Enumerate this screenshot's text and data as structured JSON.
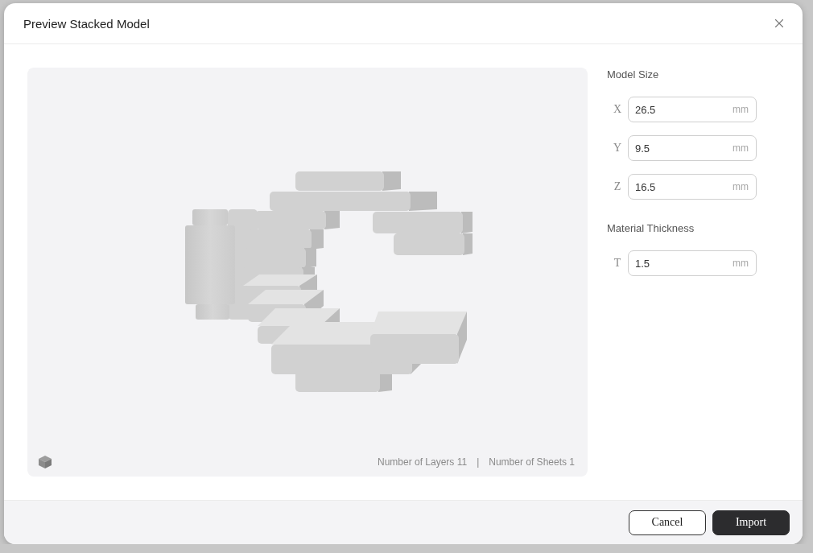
{
  "dialog": {
    "title": "Preview Stacked Model"
  },
  "viewport": {
    "stats": [
      "Number of Layers 11",
      "Number of Sheets 1"
    ],
    "separator": "|"
  },
  "panel": {
    "sections": [
      {
        "heading": "Model Size",
        "fields": [
          {
            "axis": "X",
            "value": "26.5",
            "unit": "mm"
          },
          {
            "axis": "Y",
            "value": "9.5",
            "unit": "mm"
          },
          {
            "axis": "Z",
            "value": "16.5",
            "unit": "mm"
          }
        ]
      },
      {
        "heading": "Material Thickness",
        "fields": [
          {
            "axis": "T",
            "value": "1.5",
            "unit": "mm"
          }
        ]
      }
    ]
  },
  "buttons": [
    {
      "label": "Cancel",
      "kind": "secondary"
    },
    {
      "label": "Import",
      "kind": "primary"
    }
  ]
}
